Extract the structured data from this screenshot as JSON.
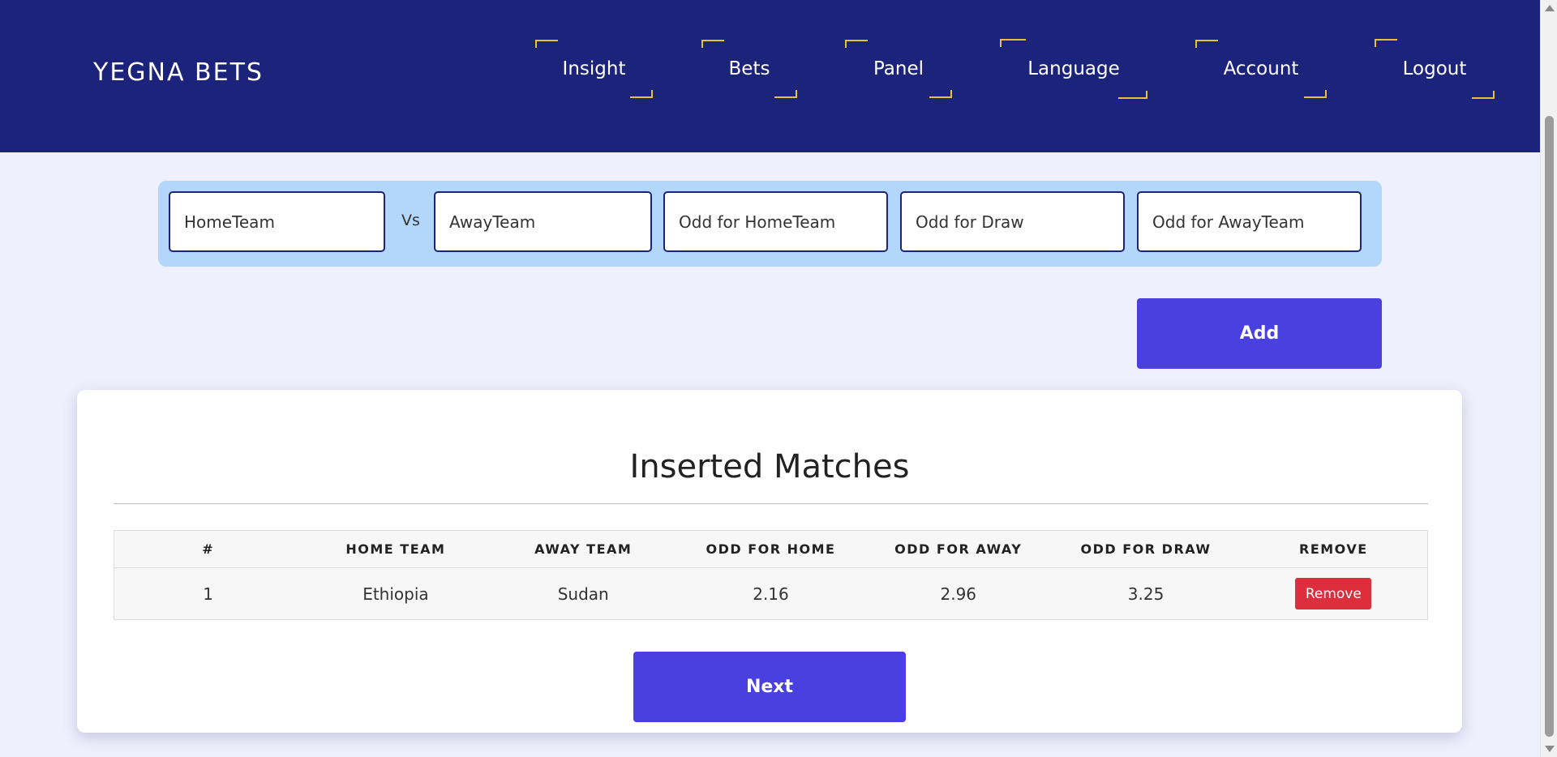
{
  "header": {
    "brand": "YEGNA BETS",
    "nav": [
      {
        "label": "Insight"
      },
      {
        "label": "Bets"
      },
      {
        "label": "Panel"
      },
      {
        "label": "Language"
      },
      {
        "label": "Account"
      },
      {
        "label": "Logout"
      }
    ]
  },
  "form": {
    "home_placeholder": "HomeTeam",
    "vs_label": "Vs",
    "away_placeholder": "AwayTeam",
    "odd_home_placeholder": "Odd for HomeTeam",
    "odd_draw_placeholder": "Odd for Draw",
    "odd_away_placeholder": "Odd for AwayTeam",
    "add_label": "Add"
  },
  "matches": {
    "title": "Inserted Matches",
    "columns": [
      "#",
      "HOME TEAM",
      "AWAY TEAM",
      "ODD FOR HOME",
      "ODD FOR AWAY",
      "ODD FOR DRAW",
      "REMOVE"
    ],
    "rows": [
      {
        "num": "1",
        "home": "Ethiopia",
        "away": "Sudan",
        "odd_home": "2.16",
        "odd_away": "2.96",
        "odd_draw": "3.25",
        "remove_label": "Remove"
      }
    ],
    "next_label": "Next"
  },
  "colors": {
    "header_bg": "#1c237b",
    "accent": "#e5c23a",
    "primary_button": "#4a40e0",
    "danger": "#dc2e3d",
    "page_bg": "#eef0fd"
  }
}
